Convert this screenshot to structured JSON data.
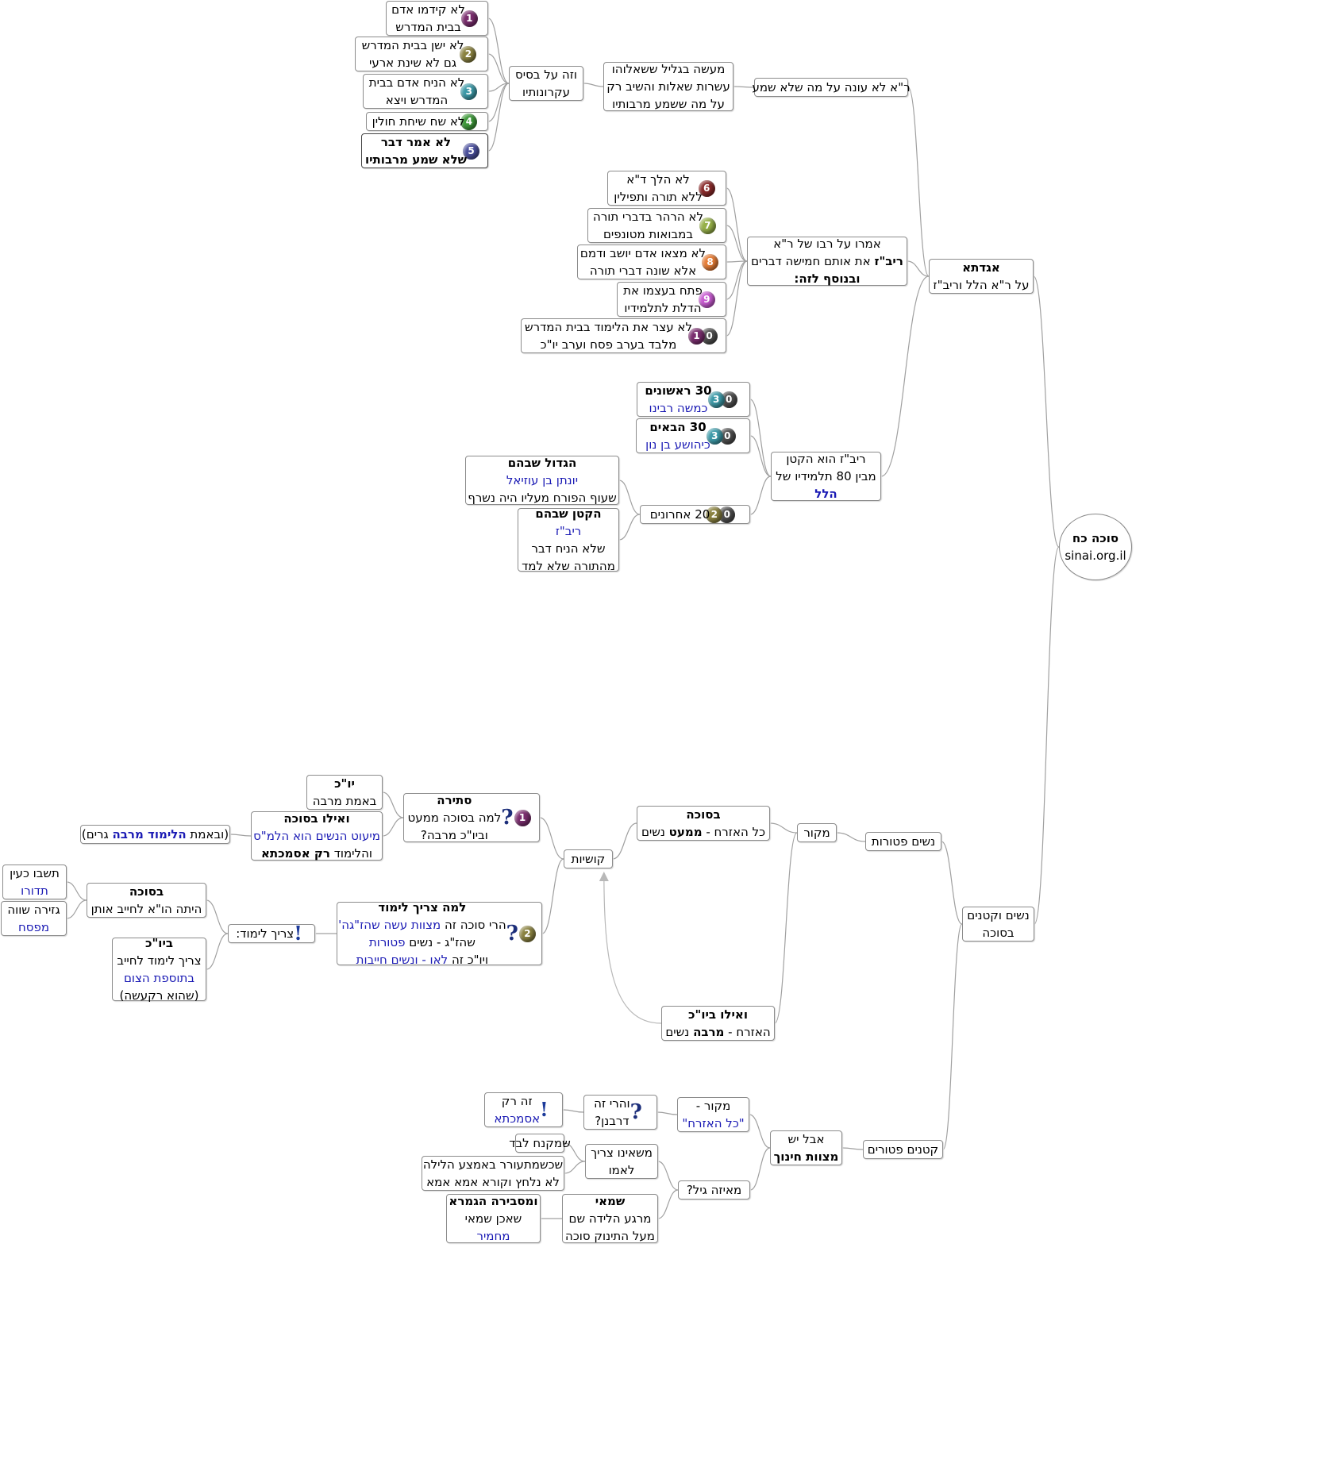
{
  "root": {
    "title": "סוכה כח",
    "site": "sinai.org.il"
  },
  "aggadata": {
    "title": "אגדתא",
    "subtitle": "על ר\"א הלל וריב\"ז",
    "ra_no_answer": "ר\"א לא עונה על מה שלא שמע",
    "story": [
      "מעשה בגליל ששאלוהו",
      "עשרות שאלות והשיב רק",
      "על מה ששמע מרבותיו"
    ],
    "basis": [
      "וזה על בסיס",
      "עקרונותיו"
    ],
    "principles": [
      {
        "n": "1",
        "lines": [
          "לא קידמו אדם",
          "בבית המדרש"
        ]
      },
      {
        "n": "2",
        "lines": [
          "לא ישן בבית המדרש",
          "גם לא שינת ארעי"
        ]
      },
      {
        "n": "3",
        "lines": [
          "לא הניח אדם בבית",
          "המדרש ויצא"
        ]
      },
      {
        "n": "4",
        "lines": [
          "לא שח שיחת חולין"
        ]
      },
      {
        "n": "5",
        "lines": [
          "לא אמר דבר",
          "שלא שמע מרבותיו"
        ]
      }
    ],
    "teacher": [
      "אמרו על רבו של ר\"א",
      "ריב\"ז",
      "את אותם חמישה דברים",
      "ובנוסף לזה:"
    ],
    "teacher_more": [
      {
        "n": "6",
        "lines": [
          "לא הלך ד\"א",
          "ללא תורה ותפילין"
        ]
      },
      {
        "n": "7",
        "lines": [
          "לא הרהר בדברי תורה",
          "במבואות מטונפים"
        ]
      },
      {
        "n": "8",
        "lines": [
          "לא מצאו אדם יושב ודמם",
          "אלא שונה דברי תורה"
        ]
      },
      {
        "n": "9",
        "lines": [
          "פתח בעצמו את",
          "הדלת לתלמידיו"
        ]
      },
      {
        "n": "10",
        "lines": [
          "לא עצר את הלימוד בבית המדרש",
          "מלבד בערב פסח וערב יו\"כ"
        ]
      }
    ],
    "ribaz_small": [
      "ריב\"ז הוא הקטן",
      "מבין 80 תלמידיו של",
      "הלל"
    ],
    "students": {
      "first": {
        "n": "30",
        "title": "30 ראשונים",
        "sub": "כמשה רבינו"
      },
      "next": {
        "n": "30",
        "title": "30 הבאים",
        "sub": "כיהושע בן נון"
      },
      "last": {
        "n": "20",
        "title": "20 אחרונים"
      },
      "greatest": [
        "הגדול שבהם",
        "יונתן בן עוזיאל",
        "שעוף הפורח מעליו היה נשרף"
      ],
      "smallest": [
        "הקטן שבהם",
        "ריב\"ז",
        "שלא הניח דבר",
        "מהתורה שלא למד"
      ]
    }
  },
  "women_children": {
    "title": [
      "נשים וקטנים",
      "בסוכה"
    ],
    "women_exempt": "נשים פטורות",
    "source": "מקור",
    "bsukka": [
      "בסוכה",
      "כל האזרח - ",
      "ממעט",
      " נשים"
    ],
    "yomkippur": [
      "ואילו ביו\"כ",
      "האזרח - ",
      "מרבה",
      " נשים"
    ],
    "difficulties": "קושיות",
    "q1": {
      "n": "1",
      "lines": [
        "סתירה",
        "למה בסוכה ממעט",
        "וביו\"כ מרבה?"
      ]
    },
    "q1_yk": [
      "יו\"כ",
      "באמת מרבה"
    ],
    "q1_sukka": [
      "ואילו בסוכה",
      "מיעוט הנשים הוא הלמ\"ס",
      "והלימוד ",
      "רק אסמכתא"
    ],
    "q1_aside": [
      "(ובאמת ",
      "הלימוד מרבה",
      " גרים)"
    ],
    "q2": {
      "n": "2",
      "lines": [
        "למה צריך לימוד",
        "הרי סוכה זה ",
        "מצוות עשה שהז\"גה'",
        "שהז\"ג - נשים ",
        "פטורות",
        "ויו\"כ זה ",
        "לאו - ונשים חייבות"
      ]
    },
    "needs_learning": "צריך לימוד:",
    "nl_sukka": [
      "בסוכה",
      "היתה הו\"א לחייב אותן"
    ],
    "nl_sukka_1": [
      "תשבו כעין",
      "תדורו"
    ],
    "nl_sukka_2": [
      "גזירה שווה",
      "מפסח"
    ],
    "nl_yk": [
      "ביו\"כ",
      "צריך לימוד לחייב",
      "בתוספת הצום",
      "(שהוא רקעשה)"
    ],
    "kids_exempt": "קטנים פטורים",
    "but_chinuch": [
      "אבל יש",
      "מצוות חינוך"
    ],
    "kid_source": [
      "מקור -",
      "\"כל האזרח\""
    ],
    "rabbinic": [
      "והרי זה",
      "דרבנן?"
    ],
    "asmachta": [
      "זה רק",
      "אסמכתא"
    ],
    "what_age": "מאיזה גיל?",
    "not_need_mother": [
      "משאינו צריך",
      "לאמו"
    ],
    "na_1": "שמקנח לבד",
    "na_2": [
      "שכשמתעורר באמצע הלילה",
      "לא נלחץ וקורא אמא אמא"
    ],
    "shammai": [
      "שמאי",
      "מרגע הלידה שם",
      "מעל התינוק סוכה"
    ],
    "gemara": [
      "ומסבירה הגמרא",
      "שאכן שמאי",
      "מחמיר"
    ]
  },
  "colors": {
    "line": "#a0a0a0",
    "text_blue": "#1a1ab4",
    "badge": {
      "1": "#7a2d6e",
      "2": "#8a8240",
      "3": "#3d9aa8",
      "4": "#3e9a3a",
      "5": "#4a4f9c",
      "6": "#8a2a2a",
      "7": "#96b048",
      "8": "#e67c35",
      "9": "#c75ad0",
      "0": "#4e4e4e"
    }
  }
}
